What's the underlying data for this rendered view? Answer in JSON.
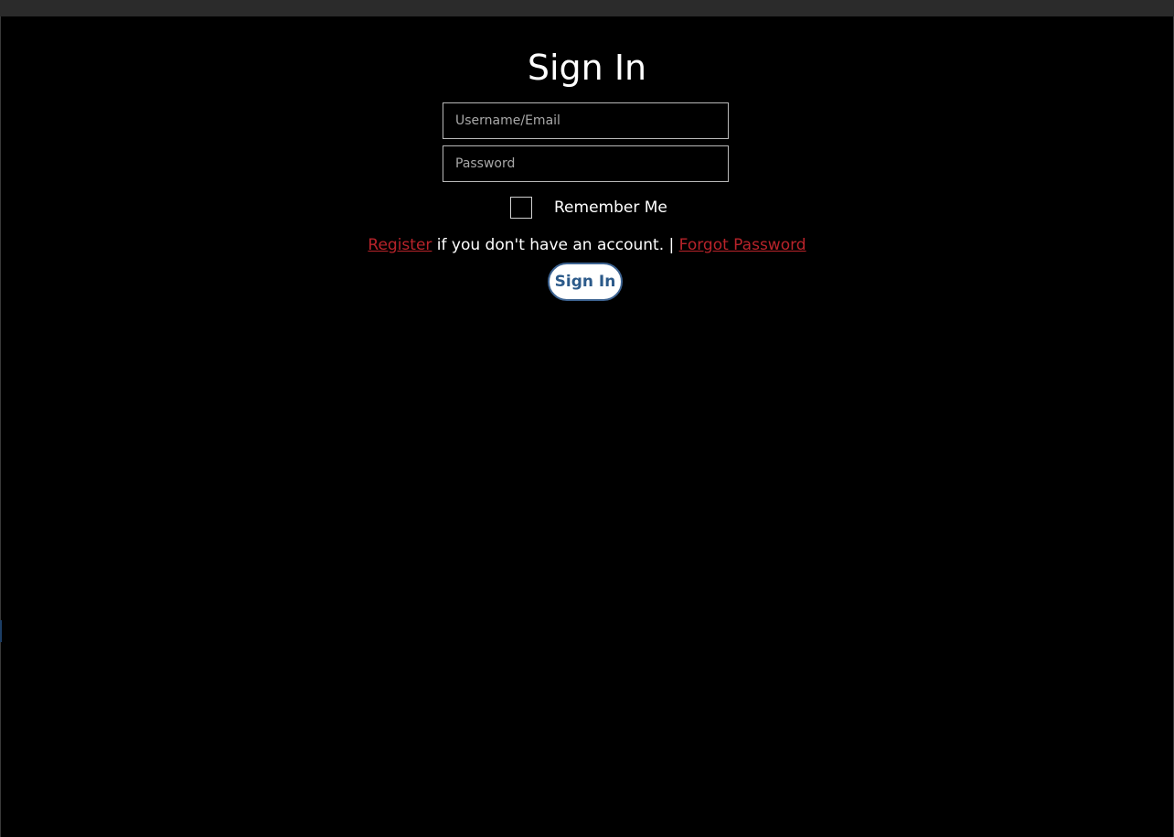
{
  "page": {
    "title": "Sign In"
  },
  "form": {
    "username_placeholder": "Username/Email",
    "username_value": "",
    "password_placeholder": "Password",
    "password_value": "",
    "remember_label": "Remember Me",
    "remember_checked": false,
    "register_link": "Register",
    "register_text": " if you don't have an account. | ",
    "forgot_link": "Forgot Password",
    "submit_label": "Sign In"
  },
  "colors": {
    "background": "#000000",
    "text": "#ffffff",
    "link": "#b8232a",
    "button_text": "#2c5a8a",
    "button_border": "#3d6391"
  }
}
